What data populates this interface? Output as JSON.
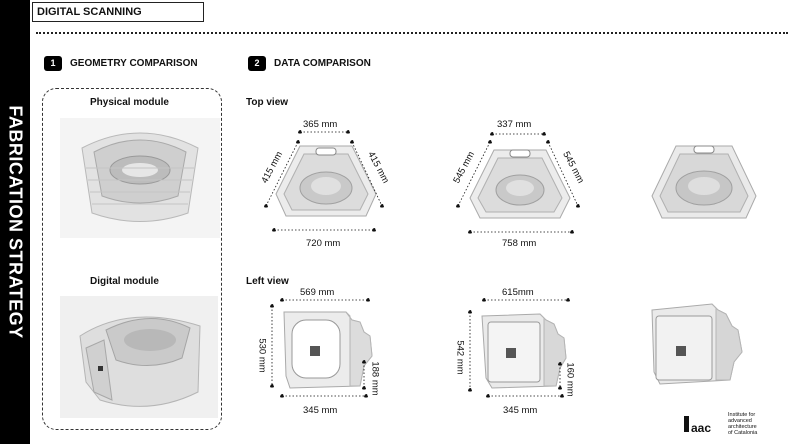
{
  "side_title": "FABRICATION STRATEGY",
  "header": {
    "title": "DIGITAL SCANNING"
  },
  "sections": [
    {
      "number": "1",
      "title": "GEOMETRY COMPARISON"
    },
    {
      "number": "2",
      "title": "DATA COMPARISON"
    }
  ],
  "geometry": {
    "physical_label": "Physical module",
    "digital_label": "Digital module"
  },
  "views": {
    "top_label": "Top view",
    "left_label": "Left view"
  },
  "top_view": {
    "model1": {
      "top": "365 mm",
      "left": "415 mm",
      "right": "415 mm",
      "bottom": "720 mm"
    },
    "model2": {
      "top": "337 mm",
      "left": "545 mm",
      "right": "545 mm",
      "bottom": "758 mm"
    }
  },
  "left_view": {
    "model1": {
      "top": "569 mm",
      "left": "530 mm",
      "right": "188 mm",
      "bottom": "345 mm"
    },
    "model2": {
      "top": "615mm",
      "left": "542 mm",
      "right": "160 mm",
      "bottom": "345 mm"
    }
  },
  "logo": {
    "mark": "IaaC",
    "lines": [
      "Institute for",
      "advanced",
      "architecture",
      "of Catalonia"
    ]
  }
}
